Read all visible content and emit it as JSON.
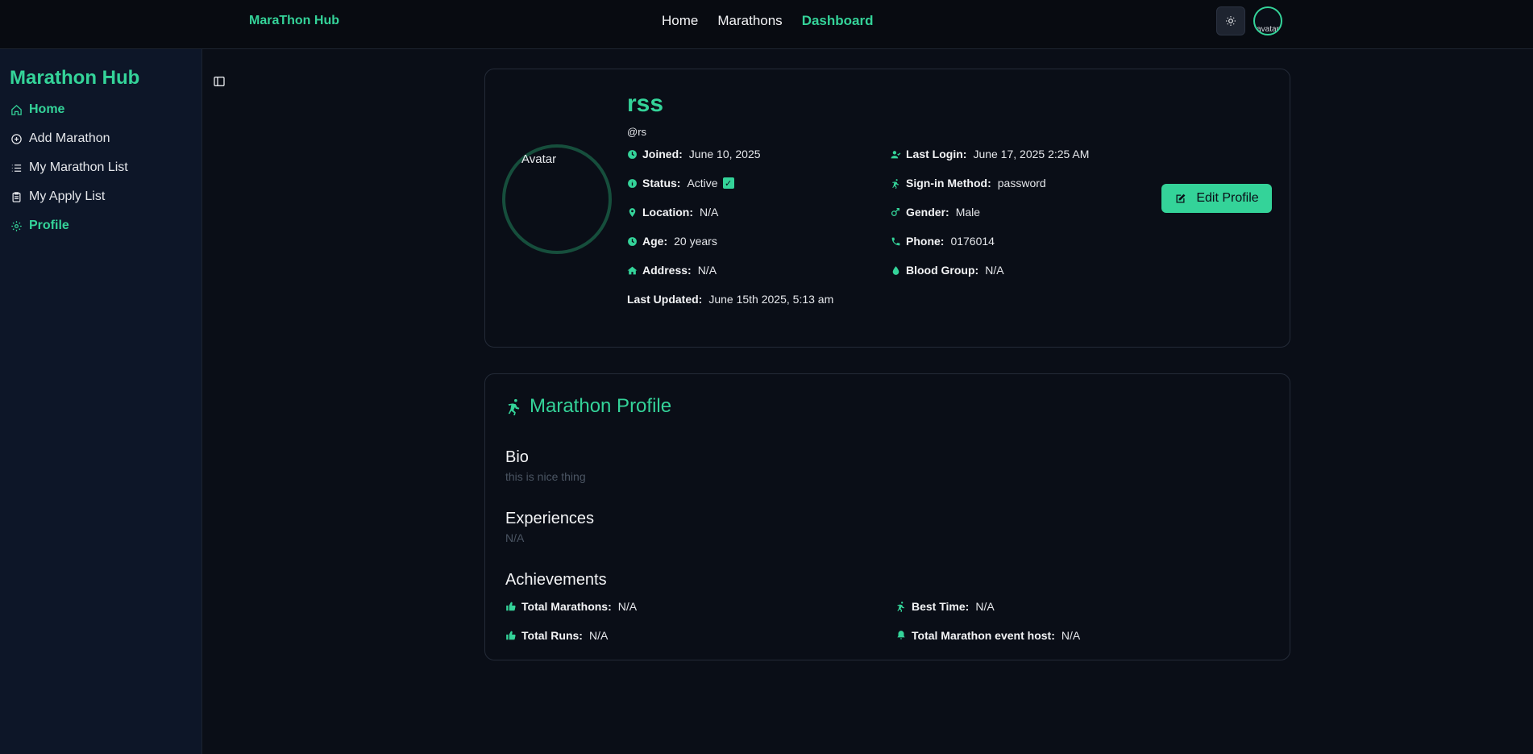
{
  "header": {
    "brand": "MaraThon Hub",
    "nav": [
      "Home",
      "Marathons",
      "Dashboard"
    ],
    "active_nav": "Dashboard",
    "theme_icon": "sun-icon",
    "avatar_alt": "avatar"
  },
  "sidebar": {
    "brand": "Marathon Hub",
    "items": [
      {
        "label": "Home",
        "icon": "home-icon",
        "active": true
      },
      {
        "label": "Add Marathon",
        "icon": "plus-circle-icon",
        "active": false
      },
      {
        "label": "My Marathon List",
        "icon": "list-icon",
        "active": false
      },
      {
        "label": "My Apply List",
        "icon": "clipboard-icon",
        "active": false
      },
      {
        "label": "Profile",
        "icon": "gear-icon",
        "active": true
      }
    ]
  },
  "profile": {
    "avatar_alt": "Avatar",
    "name": "rss",
    "handle": "@rs",
    "joined": {
      "label": "Joined:",
      "value": "June 10, 2025"
    },
    "status": {
      "label": "Status:",
      "value": "Active"
    },
    "location": {
      "label": "Location:",
      "value": "N/A"
    },
    "age": {
      "label": "Age:",
      "value": "20 years"
    },
    "address": {
      "label": "Address:",
      "value": "N/A"
    },
    "last_updated": {
      "label": "Last Updated:",
      "value": "June 15th 2025, 5:13 am"
    },
    "last_login": {
      "label": "Last Login:",
      "value": "June 17, 2025 2:25 AM"
    },
    "signin_method": {
      "label": "Sign-in Method:",
      "value": "password"
    },
    "gender": {
      "label": "Gender:",
      "value": "Male"
    },
    "phone": {
      "label": "Phone:",
      "value": "0176014"
    },
    "blood_group": {
      "label": "Blood Group:",
      "value": "N/A"
    },
    "edit_button": "Edit Profile"
  },
  "marathon_profile": {
    "title": "Marathon Profile",
    "bio_heading": "Bio",
    "bio": "this is nice thing",
    "experiences_heading": "Experiences",
    "experiences": "N/A",
    "achievements_heading": "Achievements",
    "total_marathons": {
      "label": "Total Marathons:",
      "value": "N/A"
    },
    "total_runs": {
      "label": "Total Runs:",
      "value": "N/A"
    },
    "best_time": {
      "label": "Best Time:",
      "value": "N/A"
    },
    "total_hosted": {
      "label": "Total Marathon event host:",
      "value": "N/A"
    }
  },
  "colors": {
    "accent": "#34d399",
    "background": "#0a0e17",
    "sidebar": "#0d1628"
  }
}
